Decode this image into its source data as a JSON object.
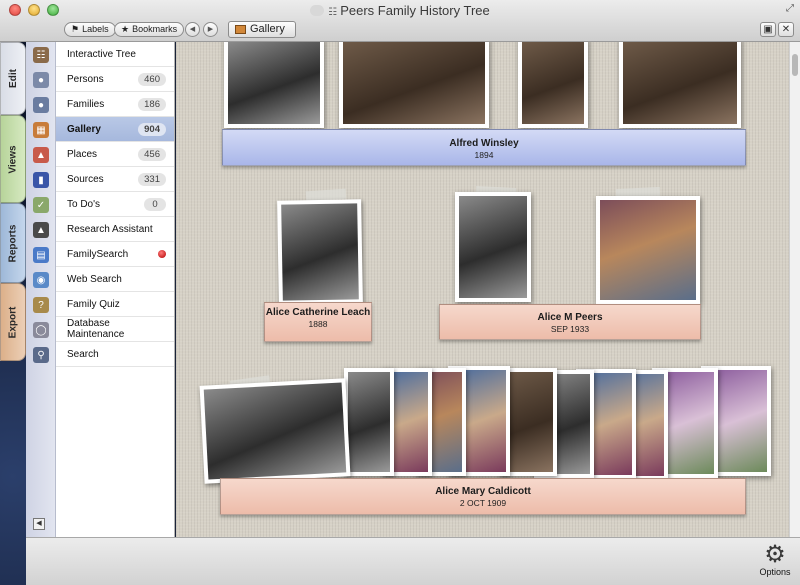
{
  "window": {
    "title": "Peers Family History Tree"
  },
  "toolbar": {
    "labels_button": "Labels",
    "bookmarks_button": "Bookmarks",
    "breadcrumb": "Gallery"
  },
  "side_tabs": [
    "Edit",
    "Views",
    "Reports",
    "Export"
  ],
  "sidebar": {
    "items": [
      {
        "label": "Interactive Tree",
        "count": ""
      },
      {
        "label": "Persons",
        "count": "460"
      },
      {
        "label": "Families",
        "count": "186"
      },
      {
        "label": "Gallery",
        "count": "904"
      },
      {
        "label": "Places",
        "count": "456"
      },
      {
        "label": "Sources",
        "count": "331"
      },
      {
        "label": "To Do's",
        "count": "0"
      },
      {
        "label": "Research Assistant",
        "count": ""
      },
      {
        "label": "FamilySearch",
        "count": ""
      },
      {
        "label": "Web Search",
        "count": ""
      },
      {
        "label": "Family Quiz",
        "count": ""
      },
      {
        "label": "Database Maintenance",
        "count": ""
      },
      {
        "label": "Search",
        "count": ""
      }
    ]
  },
  "gallery": {
    "people": [
      {
        "name": "Alfred Winsley",
        "date": "1894"
      },
      {
        "name": "Alice Catherine Leach",
        "date": "1888"
      },
      {
        "name": "Alice M Peers",
        "date": "SEP 1933"
      },
      {
        "name": "Alice Mary Caldicott",
        "date": "2 OCT 1909"
      }
    ]
  },
  "bottombar": {
    "options_label": "Options"
  },
  "colors": {
    "selected_row": "#a6b8dd",
    "blue_card": "#a9b6e9",
    "pink_card": "#edbcaa"
  }
}
